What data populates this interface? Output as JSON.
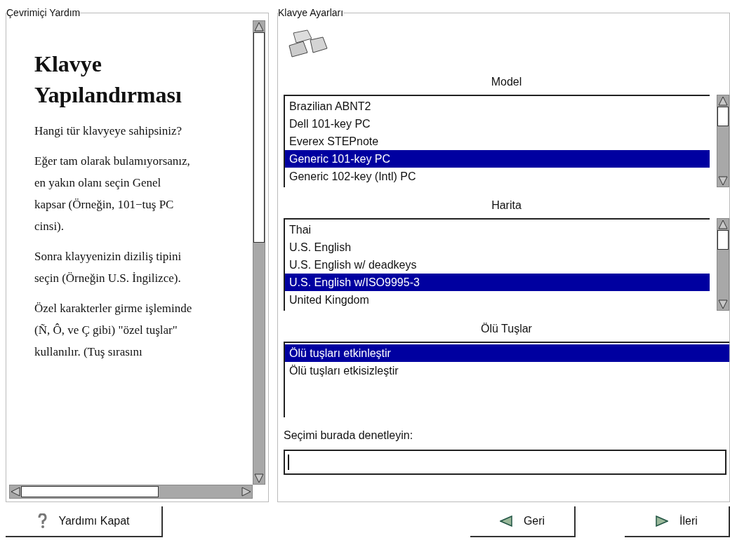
{
  "help": {
    "title": "Çevrimiçi Yardım",
    "heading": "Klavye Yapılandırması",
    "paragraphs": [
      "Hangi tür klavyeye sahipsiniz?",
      "Eğer tam olarak bulamıyorsanız, en yakın olanı seçin Genel kapsar (Örneğin, 101−tuş PC cinsi).",
      "Sonra klayyenizin diziliş tipini seçin (Örneğin U.S. İngilizce).",
      "Özel karakterler girme işleminde (Ñ, Ô, ve Ç gibi) \"özel tuşlar\" kullanılır. (Tuş sırasını"
    ]
  },
  "settings": {
    "title": "Klavye Ayarları",
    "lists": [
      {
        "label": "Model",
        "scrollbar": true,
        "items": [
          {
            "text": "Brazilian ABNT2",
            "selected": false
          },
          {
            "text": "Dell 101-key PC",
            "selected": false
          },
          {
            "text": "Everex STEPnote",
            "selected": false
          },
          {
            "text": "Generic 101-key PC",
            "selected": true
          },
          {
            "text": "Generic 102-key (Intl) PC",
            "selected": false
          }
        ]
      },
      {
        "label": "Harita",
        "scrollbar": true,
        "items": [
          {
            "text": "Thai",
            "selected": false
          },
          {
            "text": "U.S. English",
            "selected": false
          },
          {
            "text": "U.S. English w/ deadkeys",
            "selected": false
          },
          {
            "text": "U.S. English w/ISO9995-3",
            "selected": true
          },
          {
            "text": "United Kingdom",
            "selected": false
          }
        ]
      },
      {
        "label": "Ölü Tuşlar",
        "scrollbar": false,
        "items": [
          {
            "text": "Ölü tuşları etkinleştir",
            "selected": true
          },
          {
            "text": "Ölü tuşları etkisizleştir",
            "selected": false
          }
        ]
      }
    ],
    "check_label": "Seçimi burada denetleyin:"
  },
  "buttons": [
    {
      "kind": "help",
      "label": "Yardımı Kapat"
    },
    {
      "kind": "back",
      "label": "Geri"
    },
    {
      "kind": "next",
      "label": "İleri"
    }
  ]
}
